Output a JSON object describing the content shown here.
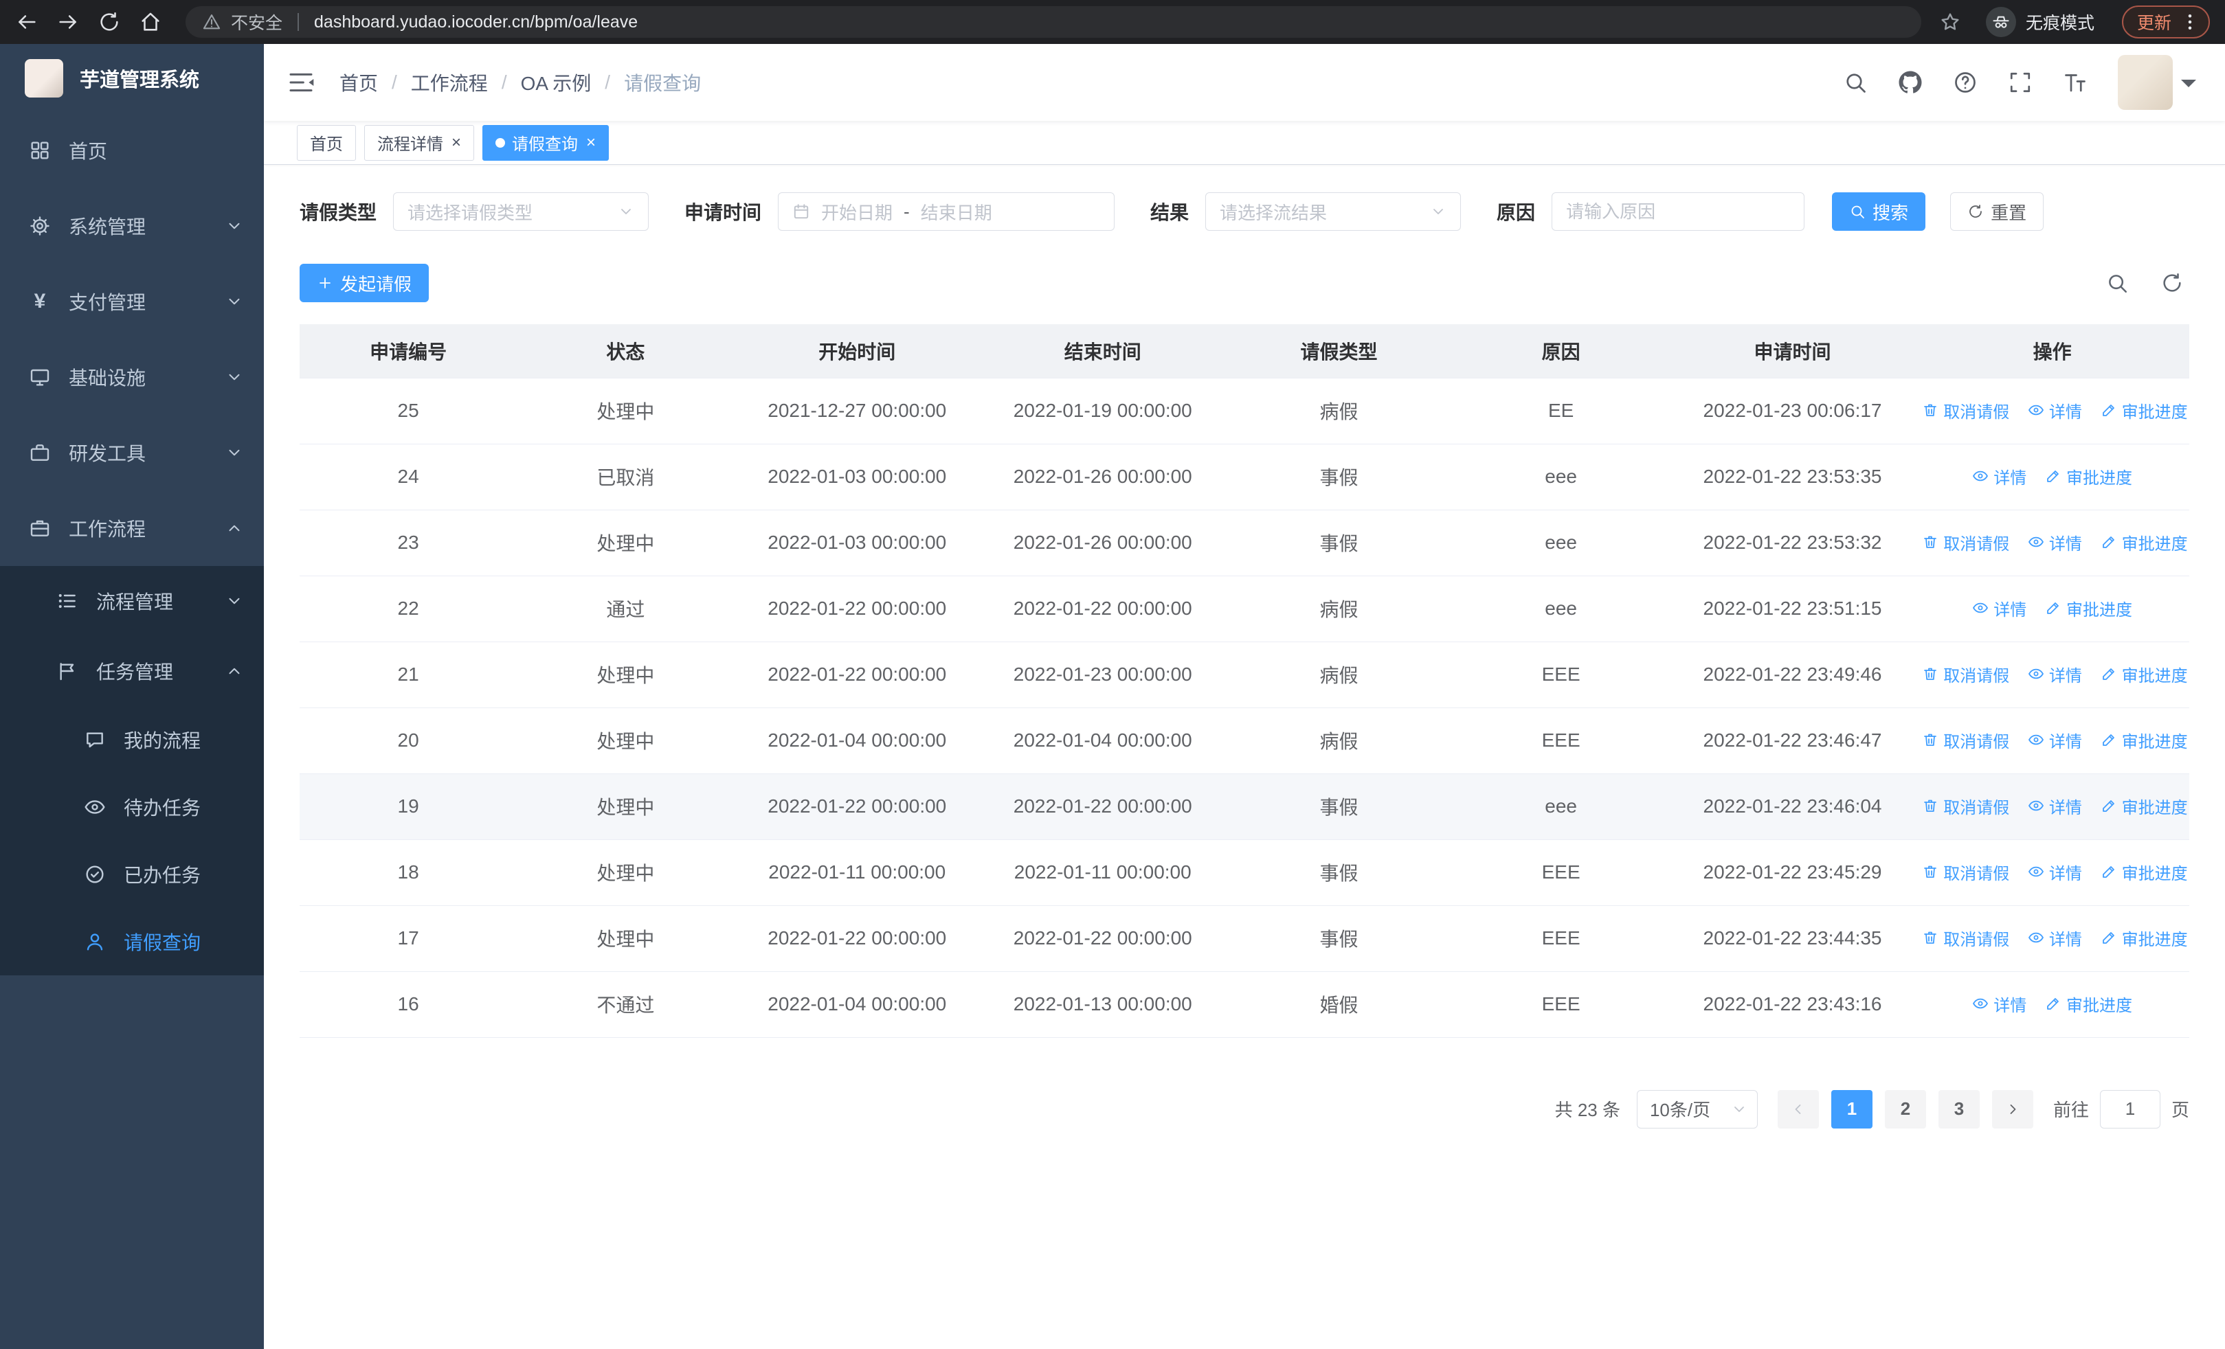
{
  "theme": {
    "accent": "#409eff",
    "sidebar_bg": "#304156",
    "submenu_bg": "#1f2d3d"
  },
  "browser": {
    "security_chip": "不安全",
    "url": "dashboard.yudao.iocoder.cn/bpm/oa/leave",
    "incognito_label": "无痕模式",
    "update_label": "更新"
  },
  "sidebar": {
    "logo_title": "芋道管理系统",
    "items": [
      {
        "label": "首页"
      },
      {
        "label": "系统管理"
      },
      {
        "label": "支付管理"
      },
      {
        "label": "基础设施"
      },
      {
        "label": "研发工具"
      },
      {
        "label": "工作流程"
      }
    ],
    "submenu": [
      {
        "label": "流程管理"
      },
      {
        "label": "任务管理"
      }
    ],
    "task_items": [
      {
        "label": "我的流程"
      },
      {
        "label": "待办任务"
      },
      {
        "label": "已办任务"
      },
      {
        "label": "请假查询"
      }
    ]
  },
  "header": {
    "breadcrumb": [
      "首页",
      "工作流程",
      "OA 示例",
      "请假查询"
    ]
  },
  "tabs": [
    {
      "label": "首页"
    },
    {
      "label": "流程详情"
    },
    {
      "label": "请假查询"
    }
  ],
  "filters": {
    "leave_type_label": "请假类型",
    "leave_type_placeholder": "请选择请假类型",
    "apply_time_label": "申请时间",
    "date_start_placeholder": "开始日期",
    "date_separator": "-",
    "date_end_placeholder": "结束日期",
    "result_label": "结果",
    "result_placeholder": "请选择流结果",
    "reason_label": "原因",
    "reason_placeholder": "请输入原因",
    "search_label": "搜索",
    "reset_label": "重置"
  },
  "toolbar": {
    "create_label": "发起请假"
  },
  "table": {
    "columns": [
      "申请编号",
      "状态",
      "开始时间",
      "结束时间",
      "请假类型",
      "原因",
      "申请时间",
      "操作"
    ],
    "action_labels": {
      "cancel": "取消请假",
      "detail": "详情",
      "progress": "审批进度"
    },
    "rows": [
      {
        "id": "25",
        "status": "处理中",
        "start": "2021-12-27 00:00:00",
        "end": "2022-01-19 00:00:00",
        "type": "病假",
        "reason": "EE",
        "apply_time": "2022-01-23 00:06:17",
        "cancellable": true
      },
      {
        "id": "24",
        "status": "已取消",
        "start": "2022-01-03 00:00:00",
        "end": "2022-01-26 00:00:00",
        "type": "事假",
        "reason": "eee",
        "apply_time": "2022-01-22 23:53:35",
        "cancellable": false
      },
      {
        "id": "23",
        "status": "处理中",
        "start": "2022-01-03 00:00:00",
        "end": "2022-01-26 00:00:00",
        "type": "事假",
        "reason": "eee",
        "apply_time": "2022-01-22 23:53:32",
        "cancellable": true
      },
      {
        "id": "22",
        "status": "通过",
        "start": "2022-01-22 00:00:00",
        "end": "2022-01-22 00:00:00",
        "type": "病假",
        "reason": "eee",
        "apply_time": "2022-01-22 23:51:15",
        "cancellable": false
      },
      {
        "id": "21",
        "status": "处理中",
        "start": "2022-01-22 00:00:00",
        "end": "2022-01-23 00:00:00",
        "type": "病假",
        "reason": "EEE",
        "apply_time": "2022-01-22 23:49:46",
        "cancellable": true
      },
      {
        "id": "20",
        "status": "处理中",
        "start": "2022-01-04 00:00:00",
        "end": "2022-01-04 00:00:00",
        "type": "病假",
        "reason": "EEE",
        "apply_time": "2022-01-22 23:46:47",
        "cancellable": true
      },
      {
        "id": "19",
        "status": "处理中",
        "start": "2022-01-22 00:00:00",
        "end": "2022-01-22 00:00:00",
        "type": "事假",
        "reason": "eee",
        "apply_time": "2022-01-22 23:46:04",
        "cancellable": true,
        "highlight": true
      },
      {
        "id": "18",
        "status": "处理中",
        "start": "2022-01-11 00:00:00",
        "end": "2022-01-11 00:00:00",
        "type": "事假",
        "reason": "EEE",
        "apply_time": "2022-01-22 23:45:29",
        "cancellable": true
      },
      {
        "id": "17",
        "status": "处理中",
        "start": "2022-01-22 00:00:00",
        "end": "2022-01-22 00:00:00",
        "type": "事假",
        "reason": "EEE",
        "apply_time": "2022-01-22 23:44:35",
        "cancellable": true
      },
      {
        "id": "16",
        "status": "不通过",
        "start": "2022-01-04 00:00:00",
        "end": "2022-01-13 00:00:00",
        "type": "婚假",
        "reason": "EEE",
        "apply_time": "2022-01-22 23:43:16",
        "cancellable": false
      }
    ]
  },
  "pagination": {
    "total_text": "共 23 条",
    "page_size_label": "10条/页",
    "pages": [
      "1",
      "2",
      "3"
    ],
    "active_page": "1",
    "goto_label": "前往",
    "goto_value": "1",
    "goto_suffix": "页"
  }
}
